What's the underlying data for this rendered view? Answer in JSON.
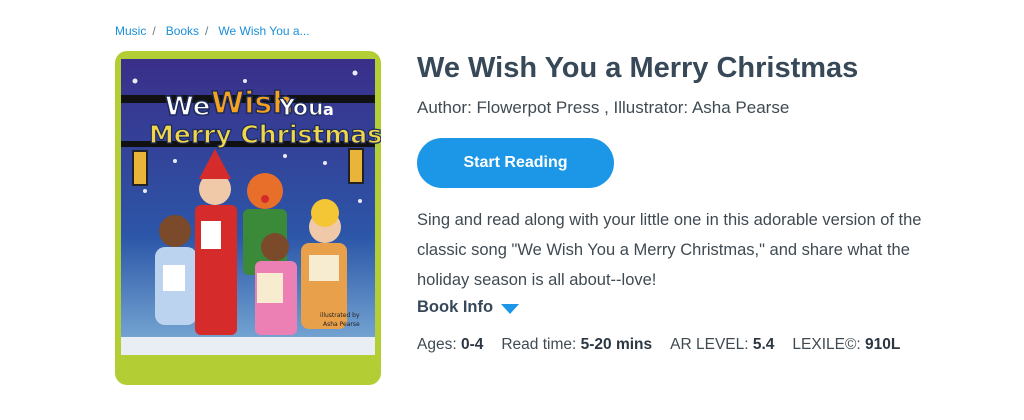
{
  "breadcrumb": {
    "items": [
      "Music",
      "Books",
      "We Wish You a..."
    ],
    "separator": "/"
  },
  "book": {
    "title": "We Wish You a Merry Christmas",
    "author_line": "Author: Flowerpot Press , Illustrator: Asha Pearse",
    "description": "Sing and read along with your little one in this adorable version of the classic song \"We Wish You a Merry Christmas,\" and share what the holiday season is all about--love!",
    "cover": {
      "title_line1_a": "We",
      "title_line1_b": "Wish",
      "title_line1_c": "You",
      "title_line1_d": "a",
      "title_line2": "Merry Christmas",
      "credit_line1": "illustrated by",
      "credit_line2": "Asha Pearse"
    }
  },
  "actions": {
    "start_reading": "Start Reading"
  },
  "book_info": {
    "label": "Book Info",
    "ages_label": "Ages:",
    "ages_value": "0-4",
    "readtime_label": "Read time:",
    "readtime_value": "5-20 mins",
    "ar_label": "AR LEVEL:",
    "ar_value": "5.4",
    "lexile_label": "LEXILE©:",
    "lexile_value": "910L"
  },
  "colors": {
    "accent": "#1c97e7",
    "cover_frame": "#b3ce34",
    "title_text": "#374858"
  },
  "icons": {
    "book_info_toggle": "caret-down-icon"
  }
}
